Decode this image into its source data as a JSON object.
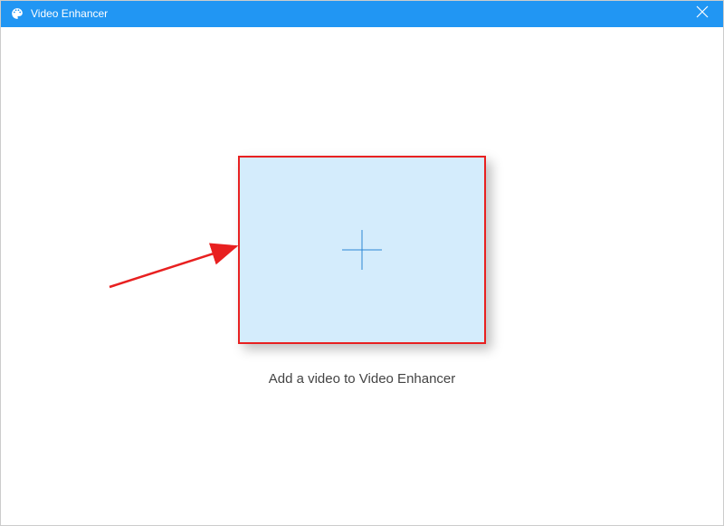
{
  "titlebar": {
    "app_name": "Video Enhancer"
  },
  "main": {
    "instruction": "Add a video to Video Enhancer"
  }
}
